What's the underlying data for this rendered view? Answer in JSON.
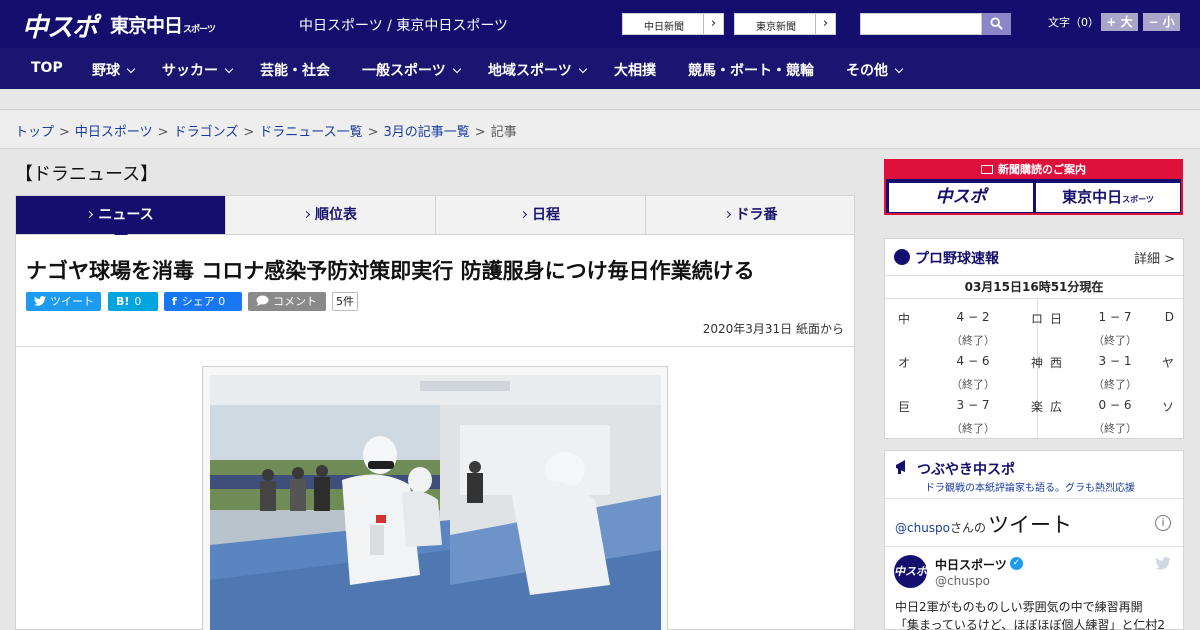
{
  "header": {
    "logo_main": "中スポ",
    "logo_tokyo": "東京中日",
    "logo_tokyo_sub": "スポーツ",
    "site_names": "中日スポーツ / 東京中日スポーツ",
    "ext_links": [
      {
        "label": "中日新聞",
        "arrow": "›"
      },
      {
        "label": "東京新聞",
        "arrow": "›"
      }
    ],
    "search_placeholder": "",
    "font_size_label": "文字（0）",
    "font_up": "+ 大",
    "font_down": "− 小"
  },
  "nav": {
    "items": [
      {
        "label": "TOP",
        "has_menu": false
      },
      {
        "label": "野球",
        "has_menu": true
      },
      {
        "label": "サッカー",
        "has_menu": true
      },
      {
        "label": "芸能・社会",
        "has_menu": false
      },
      {
        "label": "一般スポーツ",
        "has_menu": true
      },
      {
        "label": "地域スポーツ",
        "has_menu": true
      },
      {
        "label": "大相撲",
        "has_menu": false
      },
      {
        "label": "競馬・ボート・競輪",
        "has_menu": false
      },
      {
        "label": "その他",
        "has_menu": true
      }
    ]
  },
  "breadcrumb": {
    "items": [
      "トップ",
      "中日スポーツ",
      "ドラゴンズ",
      "ドラニュース一覧",
      "3月の記事一覧"
    ],
    "current": "記事",
    "separator": ">"
  },
  "section": {
    "title": "【ドラニュース】",
    "tabs": [
      {
        "label": "ニュース",
        "active": true
      },
      {
        "label": "順位表",
        "active": false
      },
      {
        "label": "日程",
        "active": false
      },
      {
        "label": "ドラ番",
        "active": false
      }
    ]
  },
  "article": {
    "headline": "ナゴヤ球場を消毒 コロナ感染予防対策即実行 防護服身につけ毎日作業続ける",
    "share": {
      "tweet": "ツイート",
      "hatena_icon": "B!",
      "hatena_count": "0",
      "facebook_icon": "f",
      "facebook_label": "シェア 0",
      "comment": "コメント",
      "comment_count": "5件"
    },
    "dateline": "2020年3月31日 紙面から"
  },
  "sidebar": {
    "subscription": {
      "heading": "新聞購読のご案内",
      "buttons": [
        "中スポ",
        "東京中日"
      ],
      "tokyo_sub": "スポーツ"
    },
    "scores": {
      "title": "プロ野球速報",
      "detail_link": "詳細 >",
      "timestamp": "03月15日16時51分現在",
      "games": [
        {
          "home": "中",
          "score": "4 − 2",
          "away": "ロ",
          "status": "（終了）"
        },
        {
          "home": "日",
          "score": "1 − 7",
          "away": "D",
          "status": "（終了）"
        },
        {
          "home": "オ",
          "score": "4 − 6",
          "away": "神",
          "status": "（終了）"
        },
        {
          "home": "西",
          "score": "3 − 1",
          "away": "ヤ",
          "status": "（終了）"
        },
        {
          "home": "巨",
          "score": "3 − 7",
          "away": "楽",
          "status": "（終了）"
        },
        {
          "home": "広",
          "score": "0 − 6",
          "away": "ソ",
          "status": "（終了）"
        }
      ]
    },
    "twitter": {
      "title": "つぶやき中スポ",
      "subtitle": "ドラ観戦の本紙評論家も語る。グラも熱烈応援",
      "handle": "@chuspo",
      "handle_suffix": "さんの",
      "tweets_word": "ツイート",
      "info": "i",
      "account_name": "中日スポーツ",
      "account_handle": "@chuspo",
      "avatar_text": "中スポ",
      "tweet_lines": [
        "中日2軍がものものしい雰囲気の中で練習再開",
        "「集まっているけど、ほぼほぼ個人練習」と仁村2"
      ]
    }
  },
  "colors": {
    "brand_navy": "#140f6e",
    "nav_navy": "#1a1570",
    "twitter_blue": "#1d9bf0",
    "facebook_blue": "#1877f2",
    "hatena_blue": "#00a4de",
    "comment_gray": "#8a8a8a",
    "subscription_red": "#e0103c"
  }
}
